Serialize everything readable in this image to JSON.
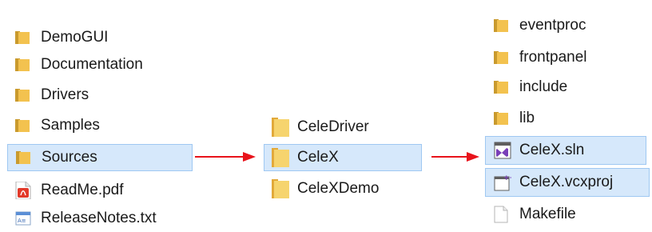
{
  "root_folder": {
    "items": [
      {
        "label": "DemoGUI",
        "icon": "folder-icon"
      },
      {
        "label": "Documentation",
        "icon": "folder-icon"
      },
      {
        "label": "Drivers",
        "icon": "folder-icon"
      },
      {
        "label": "Samples",
        "icon": "folder-icon"
      },
      {
        "label": "Sources",
        "icon": "folder-icon"
      },
      {
        "label": "ReadMe.pdf",
        "icon": "pdf-file-icon"
      },
      {
        "label": "ReleaseNotes.txt",
        "icon": "text-file-icon"
      }
    ]
  },
  "sources_folder": {
    "items": [
      {
        "label": "CeleDriver",
        "icon": "folder-icon"
      },
      {
        "label": "CeleX",
        "icon": "folder-icon"
      },
      {
        "label": "CeleXDemo",
        "icon": "folder-icon"
      }
    ]
  },
  "celex_folder": {
    "items": [
      {
        "label": "eventproc",
        "icon": "folder-icon"
      },
      {
        "label": "frontpanel",
        "icon": "folder-icon"
      },
      {
        "label": "include",
        "icon": "folder-icon"
      },
      {
        "label": "lib",
        "icon": "folder-icon"
      },
      {
        "label": "CeleX.sln",
        "icon": "visual-studio-solution-icon"
      },
      {
        "label": "CeleX.vcxproj",
        "icon": "vcxproj-file-icon"
      },
      {
        "label": "Makefile",
        "icon": "blank-file-icon"
      }
    ]
  },
  "colors": {
    "selection_bg": "#d6e8fb",
    "selection_border": "#9fc8f2",
    "arrow": "#e8131b",
    "folder": "#f3c24f"
  }
}
